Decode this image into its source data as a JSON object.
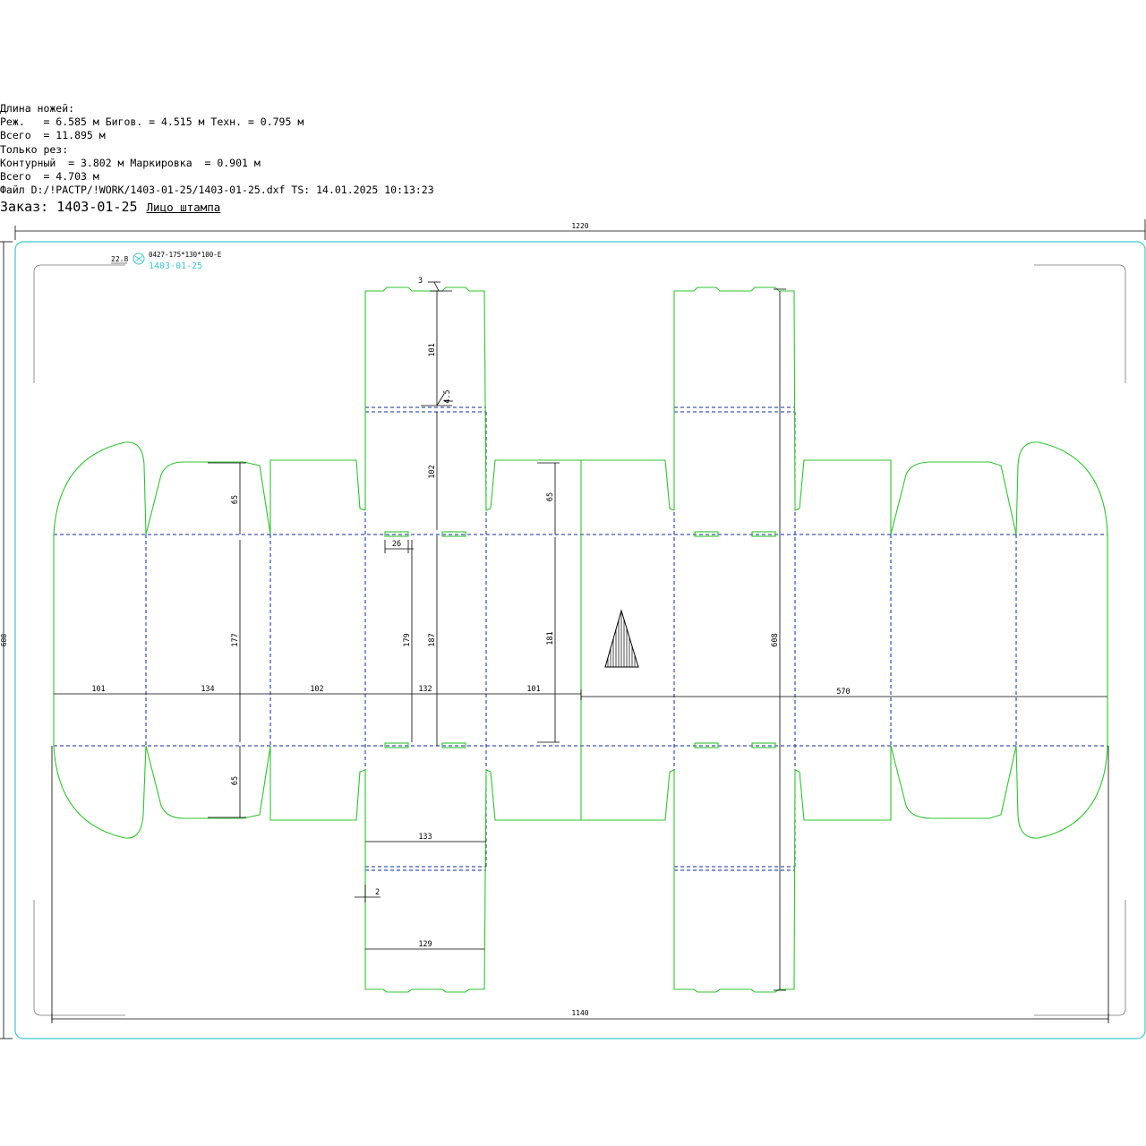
{
  "header": {
    "knife_length_title": "Длина ножей:",
    "cut_line": "Реж.   = 6.585 м Бигов. = 4.515 м Техн. = 0.795 м",
    "total_line": "Всего  = 11.895 м",
    "cut_only_title": "Только рез:",
    "contour_line": "Контурный  = 3.802 м Маркировка  = 0.901 м",
    "total2_line": "Всего  = 4.703 м",
    "file_line": "Файл D:/!РАСТР/!WORK/1403-01-25/1403-01-25.dxf TS: 14.01.2025 10:13:23",
    "order_label": "Заказ: 1403-01-25",
    "face_label": "Лицо штампа"
  },
  "stamp": {
    "code_line": "0427-175*130*100-E",
    "order_line": "1403-01-25",
    "offset_label": "22.8"
  },
  "dimensions": {
    "sheet_width": "1220",
    "sheet_height": "688",
    "base_width": "1140",
    "d_101a": "101",
    "d_134": "134",
    "d_102": "102",
    "d_132": "132",
    "d_101b": "101",
    "d_570": "570",
    "d_65a": "65",
    "d_177": "177",
    "d_65b": "65",
    "d_3": "3",
    "d_101v": "101",
    "d_4_5": "4.5",
    "d_102v": "102",
    "d_26": "26",
    "d_179": "179",
    "d_187": "187",
    "d_65c": "65",
    "d_181": "181",
    "d_608": "608",
    "d_133": "133",
    "d_2": "2",
    "d_129": "129"
  },
  "colors": {
    "cut": "#2fc42f",
    "crease": "#0b2aa8",
    "frame": "#3cc8cc",
    "dim": "#000000",
    "grey": "#777777"
  }
}
